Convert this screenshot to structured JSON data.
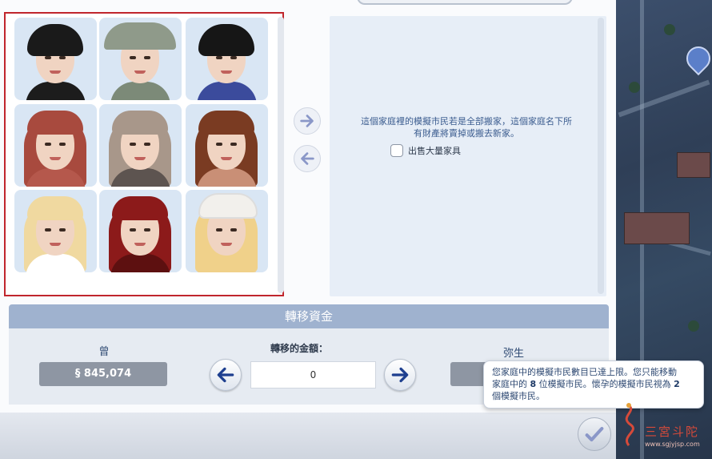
{
  "household": {
    "sims": [
      {
        "hair": "#1a1a1a",
        "style": "short",
        "top": "#1c1c1c"
      },
      {
        "hair": "#8f9a8a",
        "style": "hat",
        "top": "#7c8a78"
      },
      {
        "hair": "#161616",
        "style": "short",
        "top": "#3b4b9c"
      },
      {
        "hair": "#a84a3e",
        "style": "long",
        "top": "#b5584c"
      },
      {
        "hair": "#a8978a",
        "style": "long",
        "top": "#5d5450"
      },
      {
        "hair": "#7a3b22",
        "style": "long",
        "top": "#c98f76"
      },
      {
        "hair": "#f0d9a0",
        "style": "long",
        "top": "#ffffff"
      },
      {
        "hair": "#8c1a1a",
        "style": "long",
        "top": "#5d1010"
      },
      {
        "hair": "#f0d18a",
        "style": "beanie",
        "top": "#e7d9c4"
      }
    ]
  },
  "info": {
    "message": "這個家庭裡的模擬市民若是全部搬家，這個家庭名下所有財產將賣掉或搬去新家。",
    "sell_furniture_label": "出售大量家具"
  },
  "funds": {
    "title": "轉移資金",
    "left_household": "曾",
    "left_amount": "§ 845,074",
    "transfer_label": "轉移的金額：",
    "transfer_value": "0",
    "right_household": "弥生"
  },
  "tooltip": {
    "line1": "您家庭中的模擬市民數目已達上限。您只能移動",
    "line2_pre": "家庭中的 ",
    "line2_num": "8",
    "line2_post": " 位模擬市民。懷孕的模擬市民視為 ",
    "line2_num2": "2",
    "line3": "個模擬市民。"
  },
  "watermark": {
    "text": "三宮斗陀",
    "url": "www.sgjyjsp.com"
  }
}
